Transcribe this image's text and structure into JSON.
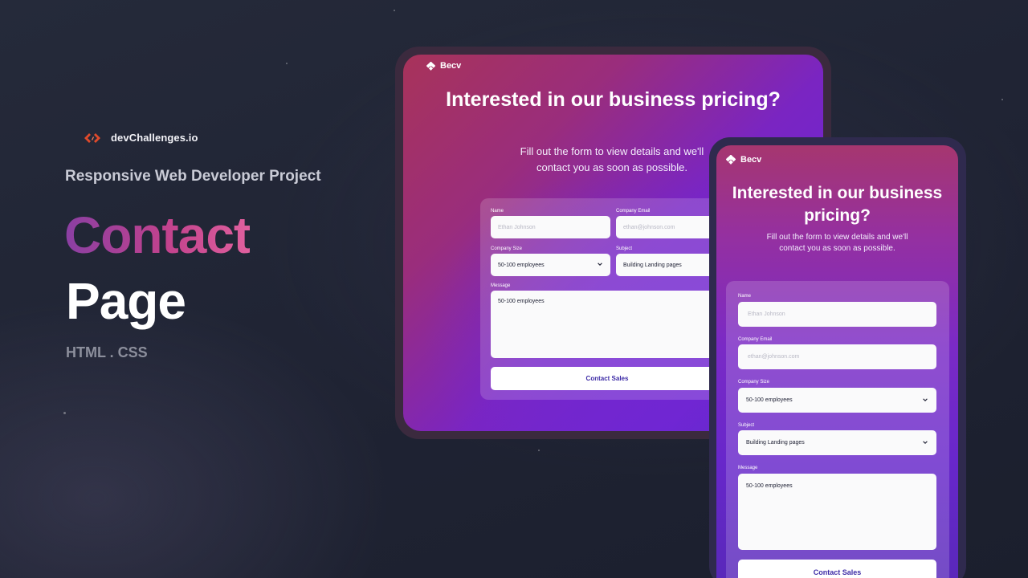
{
  "intro": {
    "brand_name": "devChallenges.io",
    "project_tag": "Responsive Web Developer Project",
    "title_line1": "Contact",
    "title_line2": "Page",
    "stack": "HTML . CSS"
  },
  "colors": {
    "background": "#1f2333",
    "accent_gradient_start": "#8a3fa3",
    "accent_gradient_end": "#e0609e",
    "button_text": "#3d2ba6",
    "brand_logo": "#e04a2b"
  },
  "tablet": {
    "logo": "Becv",
    "title": "Interested in our business pricing?",
    "subtitle": "Fill out the form to view details and we'll contact you as soon as possible.",
    "form": {
      "name_label": "Name",
      "name_placeholder": "Ethan Johnson",
      "email_label": "Company Email",
      "email_placeholder": "ethan@johnson.com",
      "size_label": "Company Size",
      "size_value": "50-100 employees",
      "subject_label": "Subject",
      "subject_value": "Building Landing pages",
      "message_label": "Message",
      "message_value": "50-100 employees",
      "submit_label": "Contact Sales"
    }
  },
  "phone": {
    "logo": "Becv",
    "title": "Interested in our business pricing?",
    "subtitle": "Fill out the form to view details and we'll contact you as soon as possible.",
    "form": {
      "name_label": "Name",
      "name_placeholder": "Ethan Johnson",
      "email_label": "Company Email",
      "email_placeholder": "ethan@johnson.com",
      "size_label": "Company Size",
      "size_value": "50-100 employees",
      "subject_label": "Subject",
      "subject_value": "Building Landing pages",
      "message_label": "Message",
      "message_value": "50-100 employees",
      "submit_label": "Contact Sales"
    }
  }
}
